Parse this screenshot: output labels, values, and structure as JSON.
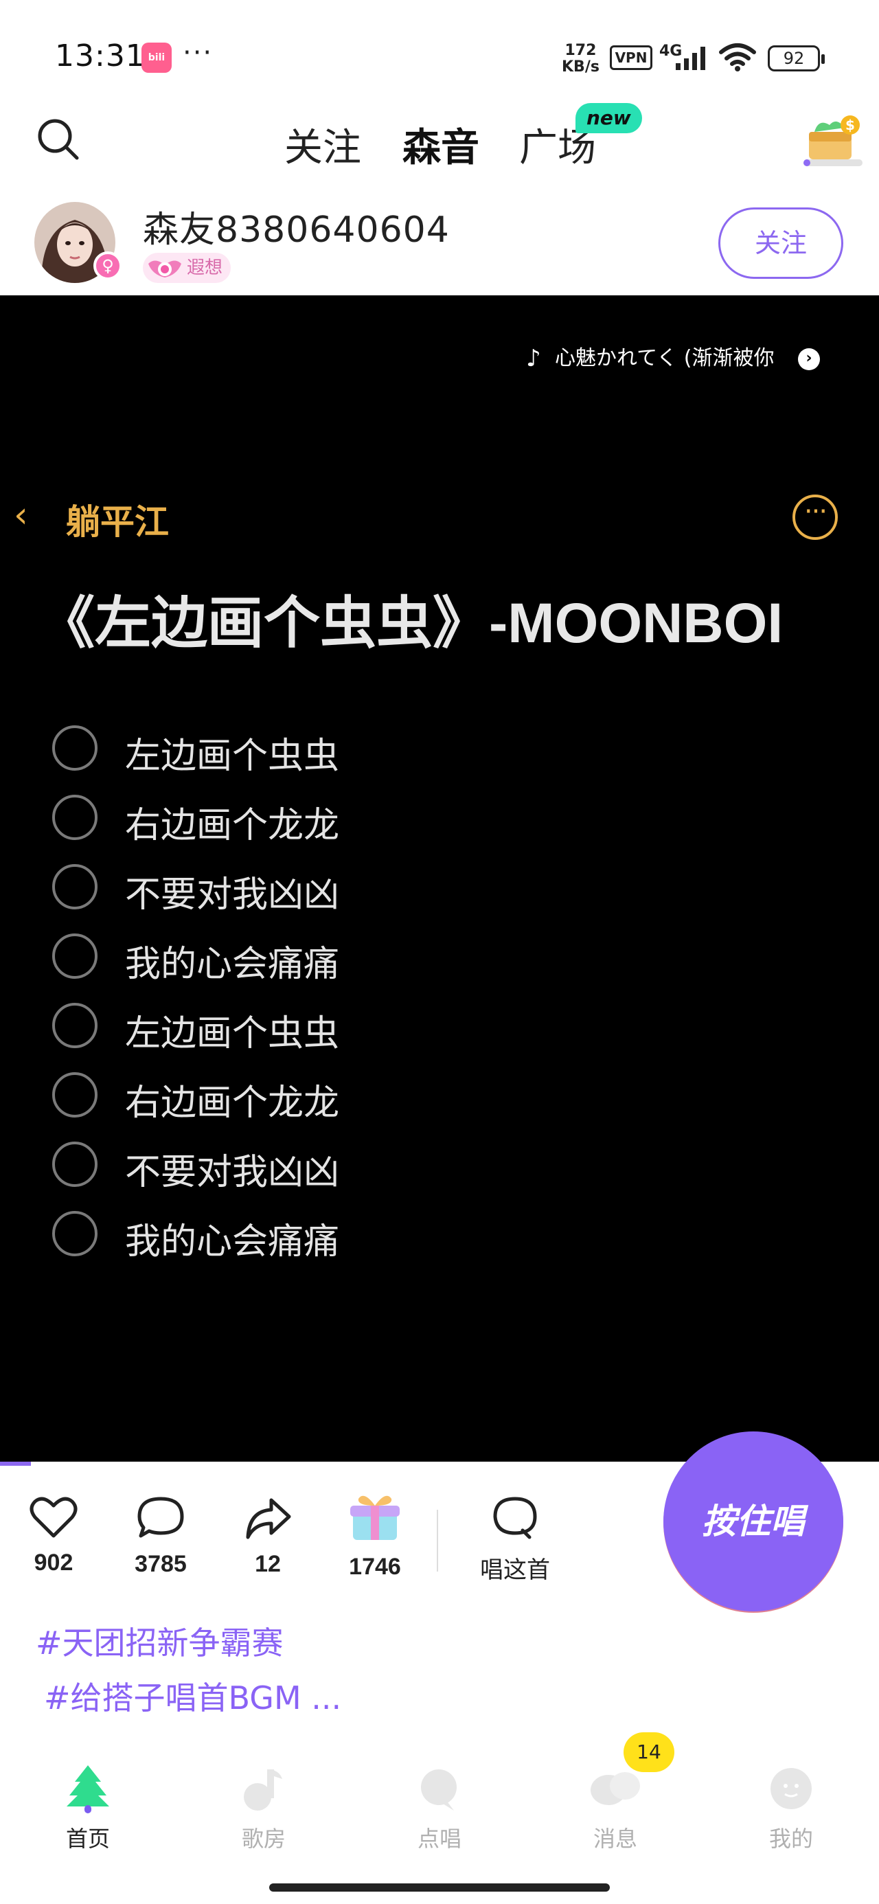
{
  "status_bar": {
    "time": "13:31",
    "app_icon": "bilibili",
    "more": "···",
    "net_speed_value": "172",
    "net_speed_unit": "KB/s",
    "vpn": "VPN",
    "network": "4G",
    "battery": "92"
  },
  "top_nav": {
    "tabs": [
      {
        "label": "关注"
      },
      {
        "label": "森音"
      },
      {
        "label": "广场"
      }
    ],
    "new_badge": "new",
    "active_tab": "森音"
  },
  "user": {
    "name": "森友8380640604",
    "gender_symbol": "♀",
    "level_label": "遐想",
    "follow_label": "关注"
  },
  "video": {
    "music_note": "♪",
    "music_title": "心魅かれてく (渐渐被你",
    "music_arrow": "›",
    "back_label": "躺平江",
    "more_label": "···",
    "heading": "《左边画个虫虫》-MOONBOI",
    "lyrics": [
      "左边画个虫虫",
      "右边画个龙龙",
      "不要对我凶凶",
      "我的心会痛痛",
      "左边画个虫虫",
      "右边画个龙龙",
      "不要对我凶凶",
      "我的心会痛痛"
    ],
    "progress": 0.035
  },
  "actions": {
    "likes": "902",
    "comments": "3785",
    "shares": "12",
    "gifts": "1746",
    "sing_this": "唱这首",
    "hold_to_sing": "按住唱"
  },
  "hashtags": [
    "#天团招新争霸赛",
    "#给搭子唱首BGM ..."
  ],
  "bottom_nav": {
    "items": [
      {
        "label": "首页"
      },
      {
        "label": "歌房"
      },
      {
        "label": "点唱"
      },
      {
        "label": "消息"
      },
      {
        "label": "我的"
      }
    ],
    "messages_badge": "14"
  },
  "colors": {
    "accent": "#8a63f5",
    "tab_underline": "#4ee3c2",
    "new_badge": "#28e0b3",
    "video_gold": "#e9b04a",
    "message_badge": "#ffe11a"
  }
}
